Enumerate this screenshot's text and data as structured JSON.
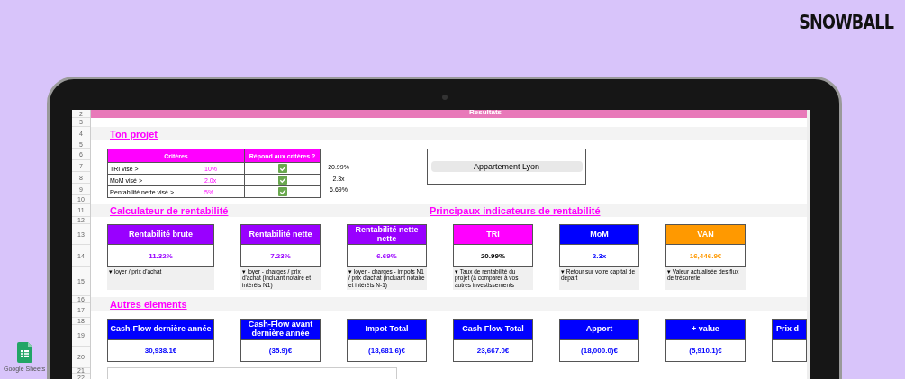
{
  "brand": {
    "logo": "SNOWBALL",
    "app_label": "Google Sheets"
  },
  "sheet": {
    "row_numbers": [
      "2",
      "3",
      "4",
      "5",
      "6",
      "7",
      "8",
      "9",
      "10",
      "11",
      "12",
      "13",
      "14",
      "15",
      "16",
      "17",
      "18",
      "19",
      "20",
      "21",
      "22"
    ],
    "banner": "Resultats",
    "project": {
      "title": "Ton projet",
      "headers": [
        "Critères",
        "Répond aux critères ?"
      ],
      "criteria": [
        {
          "label": "TRI visé >",
          "target": "10%",
          "checked": true,
          "actual": "20.99%"
        },
        {
          "label": "MoM visé >",
          "target": "2.0x",
          "checked": true,
          "actual": "2.3x"
        },
        {
          "label": "Rentabilité nette visé >",
          "target": "5%",
          "checked": true,
          "actual": "6.69%"
        }
      ],
      "project_name": "Appartement Lyon"
    },
    "calculator": {
      "title": "Calculateur de rentabilité",
      "indicators_title": "Principaux indicateurs de rentabilité",
      "cards": [
        {
          "title": "Rentabilité brute",
          "value": "11.32%",
          "color": "#9900ff",
          "note": "▾ loyer / prix d'achat"
        },
        {
          "title": "Rentabilité nette",
          "value": "7.23%",
          "color": "#9900ff",
          "note": "▾ loyer - charges / prix d'achat (incluant notaire et intérêts N1)"
        },
        {
          "title": "Rentabilité nette nette",
          "value": "6.69%",
          "color": "#9900ff",
          "note": "▾ loyer - charges - impots N1 / prix d'achat (incluant notaire et intérêts N-1)"
        },
        {
          "title": "TRI",
          "value": "20.99%",
          "color": "#ff00ff",
          "note": "▾ Taux de rentabilité du projet (à comparer à vos autres investissements"
        },
        {
          "title": "MoM",
          "value": "2.3x",
          "color": "#0000ff",
          "note": "▾ Retour sur votre capital de départ"
        },
        {
          "title": "VAN",
          "value": "16,446.9€",
          "color": "#ff9900",
          "note": "▾ Valeur actualisée des flux de trésorerie"
        }
      ]
    },
    "others": {
      "title": "Autres elements",
      "cards": [
        {
          "title": "Cash-Flow dernière année",
          "value": "30,938.1€",
          "color": "#0000ff"
        },
        {
          "title": "Cash-Flow avant dernière année",
          "value": "(35.9)€",
          "color": "#0000ff"
        },
        {
          "title": "Impot Total",
          "value": "(18,681.6)€",
          "color": "#0000ff"
        },
        {
          "title": "Cash Flow Total",
          "value": "23,667.0€",
          "color": "#0000ff"
        },
        {
          "title": "Apport",
          "value": "(18,000.0)€",
          "color": "#0000ff"
        },
        {
          "title": "+ value",
          "value": "(5,910.1)€",
          "color": "#0000ff"
        },
        {
          "title": "Prix d",
          "color": "#0000ff"
        }
      ]
    }
  }
}
